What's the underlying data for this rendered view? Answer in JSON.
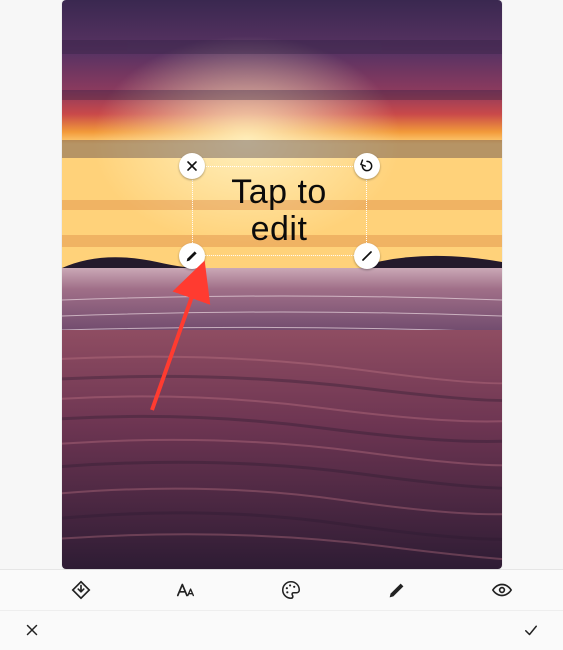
{
  "overlay": {
    "text": "Tap to\nedit"
  },
  "handles": {
    "close": "close-icon",
    "rotate": "rotate-icon",
    "edit": "pencil-icon",
    "resize": "resize-icon"
  },
  "style_toolbar": {
    "items": [
      {
        "name": "fill-download-icon"
      },
      {
        "name": "font-size-icon"
      },
      {
        "name": "palette-icon"
      },
      {
        "name": "pencil-icon"
      },
      {
        "name": "eye-icon"
      }
    ]
  },
  "main_toolbar": {
    "cancel": "✕",
    "confirm": "✓"
  },
  "annotation": {
    "color": "#ff3b30"
  }
}
